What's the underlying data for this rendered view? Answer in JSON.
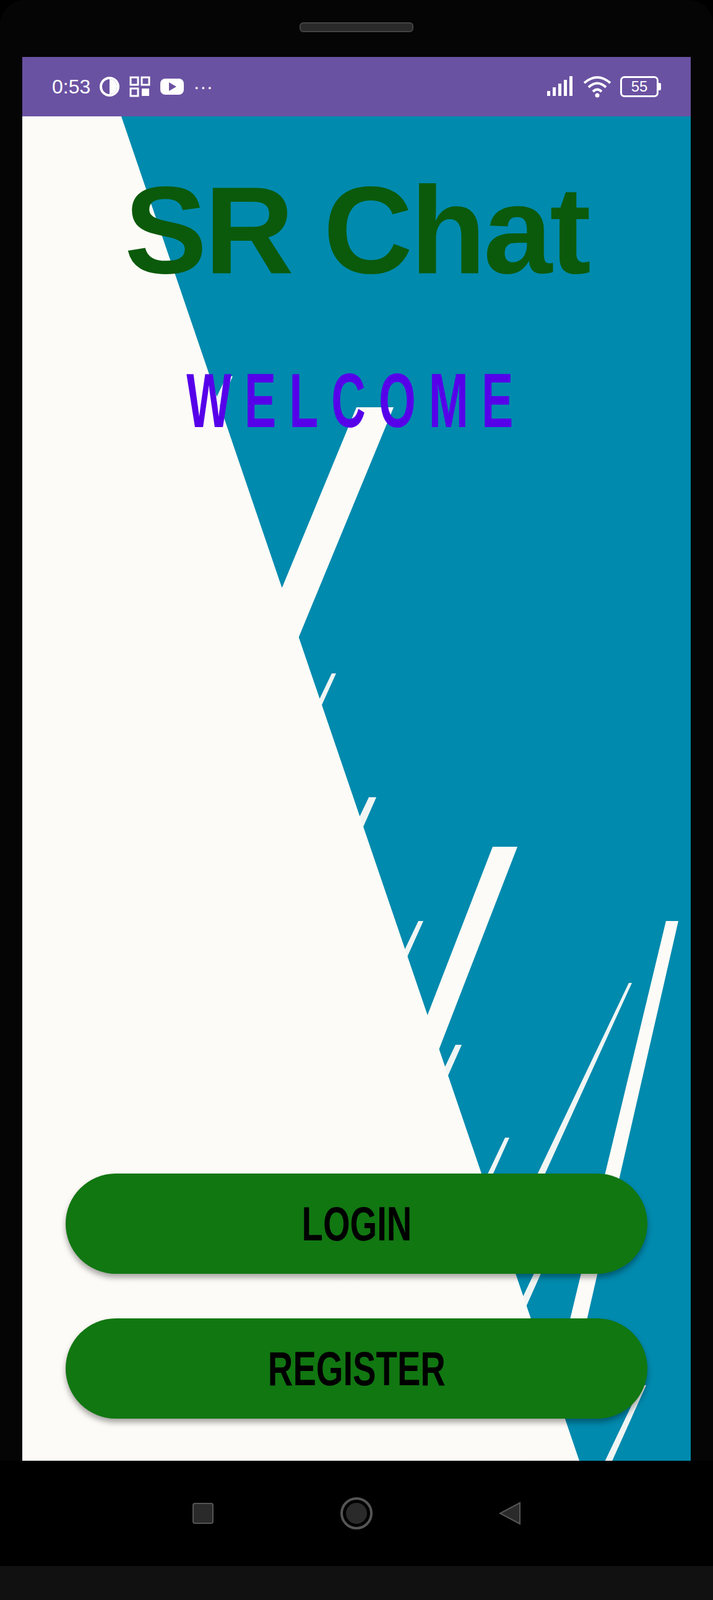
{
  "status_bar": {
    "time": "0:53",
    "more": "···",
    "battery": "55"
  },
  "app": {
    "title": "SR Chat",
    "subtitle": "WELCOME"
  },
  "buttons": [
    {
      "label": "LOGIN"
    },
    {
      "label": "REGISTER"
    }
  ]
}
